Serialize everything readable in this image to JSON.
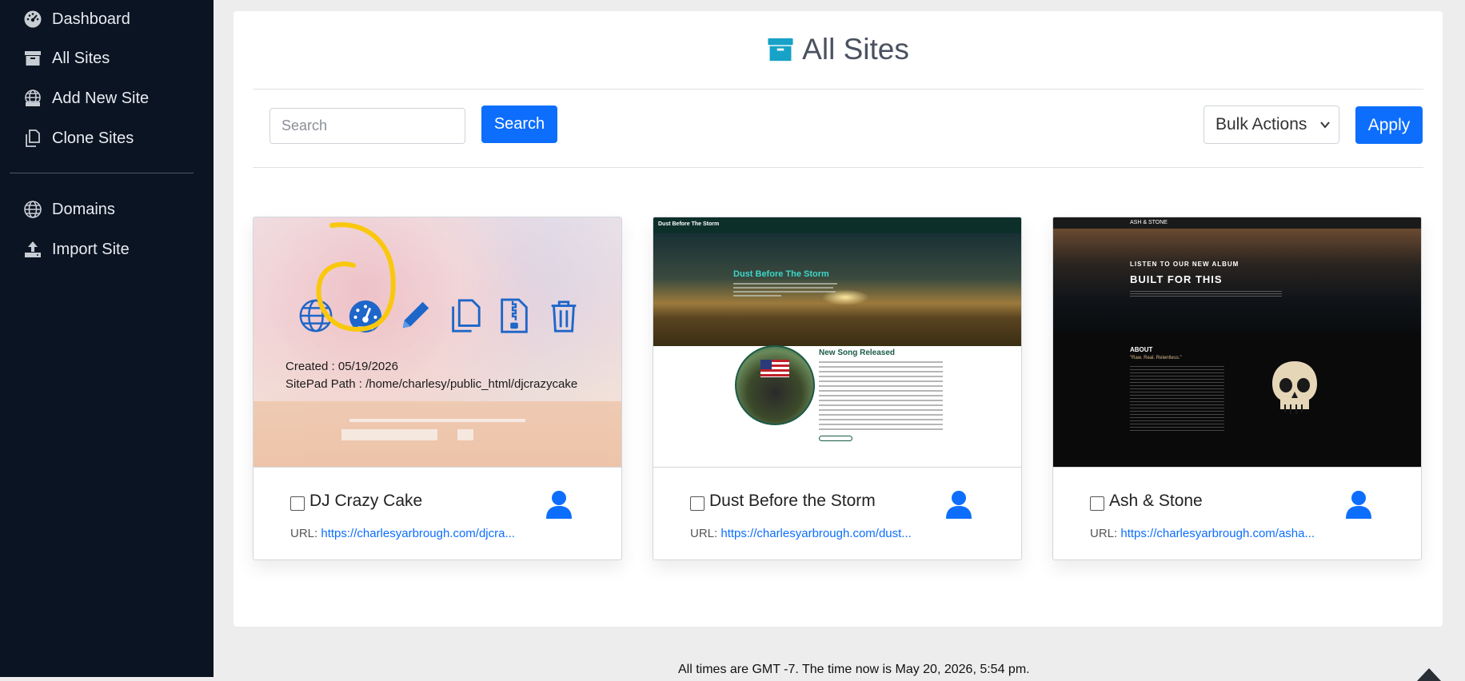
{
  "sidebar": {
    "items": [
      {
        "label": "Dashboard",
        "icon": "dashboard-icon"
      },
      {
        "label": "All Sites",
        "icon": "archive-icon"
      },
      {
        "label": "Add New Site",
        "icon": "globe-plus-icon"
      },
      {
        "label": "Clone Sites",
        "icon": "copy-icon"
      },
      {
        "label": "Domains",
        "icon": "globe-icon"
      },
      {
        "label": "Import Site",
        "icon": "upload-icon"
      }
    ]
  },
  "header": {
    "title": "All Sites",
    "icon": "archive-icon"
  },
  "toolbar": {
    "search_placeholder": "Search",
    "search_label": "Search",
    "bulk_selected": "Bulk Actions",
    "apply_label": "Apply"
  },
  "sites": [
    {
      "name": "DJ Crazy Cake",
      "url_label": "URL:",
      "url": "https://charlesyarbrough.com/djcra...",
      "created": "Created : 05/19/2026",
      "path": "SitePad Path : /home/charlesy/public_html/djcrazycake",
      "actions": [
        "globe-icon",
        "gauge-icon",
        "pencil-icon",
        "copy-icon",
        "zip-file-icon",
        "trash-icon"
      ]
    },
    {
      "name": "Dust Before the Storm",
      "url_label": "URL:",
      "url": "https://charlesyarbrough.com/dust...",
      "preview": {
        "brand": "Dust Before The Storm",
        "hero_title": "Dust Before The Storm",
        "song_heading": "New Song Released"
      }
    },
    {
      "name": "Ash & Stone",
      "url_label": "URL:",
      "url": "https://charlesyarbrough.com/asha...",
      "preview": {
        "brand": "ASH & STONE",
        "kicker": "LISTEN TO OUR NEW ALBUM",
        "album": "BUILT FOR THIS",
        "about_heading": "ABOUT",
        "about_tagline": "\"Raw. Real. Relentless.\""
      }
    }
  ],
  "footer": {
    "text": "All times are GMT -7. The time now is May 20, 2026, 5:54 pm."
  },
  "colors": {
    "sidebar_bg": "#0b1422",
    "primary": "#0d6efd",
    "annotation": "#f9c80e",
    "action_icon": "#1e66c9"
  }
}
